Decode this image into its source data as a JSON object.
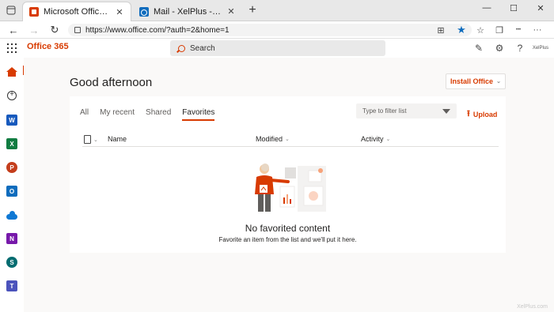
{
  "browser": {
    "tabs": [
      {
        "label": "Microsoft Office Home",
        "icon": "office-icon",
        "active": true
      },
      {
        "label": "Mail - XelPlus - Outlook",
        "icon": "outlook-icon",
        "active": false
      }
    ],
    "url": "https://www.office.com/?auth=2&home=1",
    "window_controls": {
      "minimize": "—",
      "maximize": "☐",
      "close": "✕"
    }
  },
  "header": {
    "brand": "Office 365",
    "search_placeholder": "Search",
    "avatar_text": "XelPlus"
  },
  "rail": {
    "items": [
      {
        "name": "home-icon",
        "selected": true
      },
      {
        "name": "create-icon",
        "glyph": "+"
      },
      {
        "name": "word-icon",
        "letter": "W",
        "color": "#185abd"
      },
      {
        "name": "excel-icon",
        "letter": "X",
        "color": "#107c41"
      },
      {
        "name": "powerpoint-icon",
        "letter": "P",
        "color": "#c43e1c"
      },
      {
        "name": "outlook-icon",
        "letter": "O",
        "color": "#0f6cbd"
      },
      {
        "name": "onedrive-icon"
      },
      {
        "name": "onenote-icon",
        "letter": "N",
        "color": "#7719aa"
      },
      {
        "name": "sharepoint-icon",
        "letter": "S",
        "color": "#036c70"
      },
      {
        "name": "teams-icon",
        "letter": "T",
        "color": "#4b53bc"
      }
    ]
  },
  "main": {
    "greeting": "Good afternoon",
    "install_button": "Install Office",
    "tabs": [
      "All",
      "My recent",
      "Shared",
      "Favorites"
    ],
    "active_tab": "Favorites",
    "filter_placeholder": "Type to filter list",
    "upload_label": "Upload",
    "columns": [
      "Name",
      "Modified",
      "Activity"
    ],
    "empty_title": "No favorited content",
    "empty_subtitle": "Favorite an item from the list and we'll put it here."
  },
  "colors": {
    "accent": "#d83b01"
  },
  "watermark": "XelPlus.com"
}
